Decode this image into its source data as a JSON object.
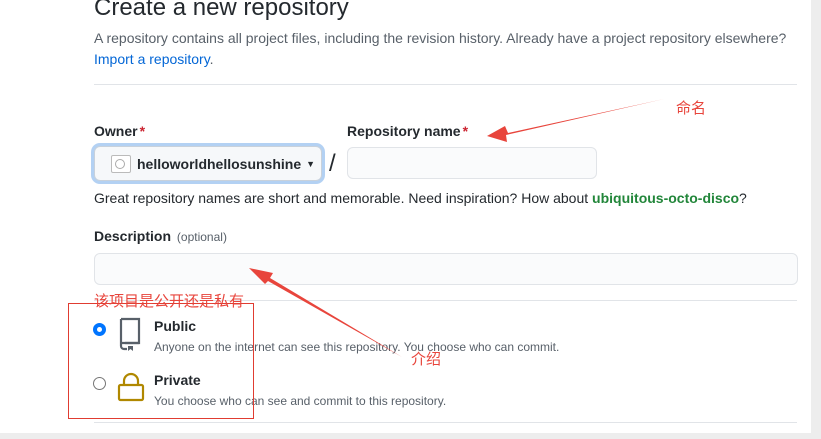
{
  "header": {
    "title": "Create a new repository",
    "subtitle": "A repository contains all project files, including the revision history. Already have a project repository elsewhere?",
    "import_link": "Import a repository",
    "import_suffix": "."
  },
  "owner": {
    "label": "Owner",
    "required": "*",
    "value": "helloworldhellosunshine"
  },
  "repo_name": {
    "label": "Repository name",
    "required": "*",
    "value": ""
  },
  "separator": "/",
  "hint": {
    "text": "Great repository names are short and memorable. Need inspiration? How about",
    "suggestion": "ubiquitous-octo-disco",
    "suffix": "?"
  },
  "description": {
    "label": "Description",
    "optional": "(optional)",
    "value": ""
  },
  "visibility": [
    {
      "title": "Public",
      "desc": "Anyone on the internet can see this repository. You choose who can commit.",
      "checked": true,
      "icon": "repo-icon"
    },
    {
      "title": "Private",
      "desc": "You choose who can see and commit to this repository.",
      "checked": false,
      "icon": "lock-icon"
    }
  ],
  "annotations": {
    "name_note": "命名",
    "visibility_note": "该项目是公开还是私有",
    "description_note": "介绍",
    "color": "#e8453c"
  },
  "colors": {
    "link": "#0366d6",
    "suggestion": "#22863a",
    "required": "#cb2431",
    "lock": "#b08800"
  }
}
